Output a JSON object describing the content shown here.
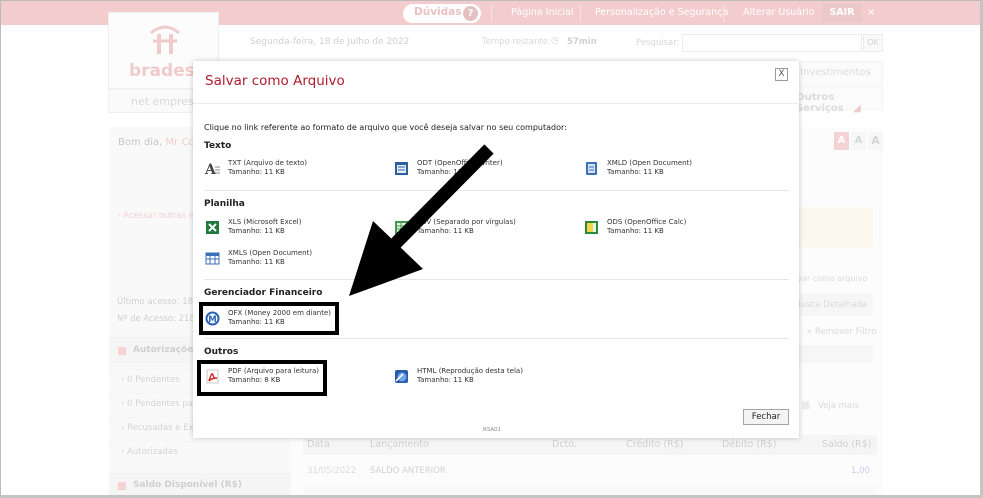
{
  "topbar": {
    "duvidas": "Dúvidas",
    "links": [
      "Página Inicial",
      "Personalização e Segurança",
      "Alterar Usuário"
    ],
    "sair": "SAIR",
    "close": "×"
  },
  "brand": {
    "logo_text": "bradesco",
    "sub_label": "net empresa"
  },
  "header": {
    "date": "Segunda-feira, 18 de Julho de 2022",
    "time_label": "Tempo restante:",
    "time_value": "57min",
    "search_label": "Pesquisar:",
    "search_value": "",
    "ok_label": "OK"
  },
  "nav": {
    "investimentos": "Investimentos",
    "outros_servicos": "Outros Serviços"
  },
  "left_panel": {
    "greeting": "Bom dia,",
    "user": "Mr Co",
    "acessar": "Acessar outras e",
    "ultimo_acesso": "Último acesso: 18/",
    "num_acesso": "Nº de Acesso: 218",
    "autorizacoes": "Autorizações",
    "items": [
      "0 Pendentes",
      "0 Pendentes para",
      "Recusadas e Exp",
      "Autorizadas"
    ],
    "saldo": "Saldo Disponível (R$)"
  },
  "right_panel": {
    "font_sizes": [
      "A",
      "A",
      "A"
    ],
    "salvar_como": "lvar como arquivo",
    "busca_detalhada": "Busca Detalhada",
    "remover_filtro": "» Remover Filtro",
    "veja_mais": "Veja mais"
  },
  "table": {
    "headers": [
      "Data",
      "Lançamento",
      "Dcto.",
      "Crédito (R$)",
      "Débito (R$)",
      "Saldo (R$)"
    ],
    "rows": [
      {
        "data": "31/05/2022",
        "lancamento": "SALDO ANTERIOR",
        "dcto": "",
        "credito": "",
        "debito": "",
        "saldo": "1,00"
      }
    ]
  },
  "modal": {
    "title": "Salvar como Arquivo",
    "close": "X",
    "intro": "Clique no link referente ao formato de arquivo que você deseja salvar no seu computador:",
    "sections": {
      "texto": {
        "title": "Texto",
        "items": [
          {
            "name": "TXT (Arquivo de texto)",
            "size": "Tamanho: 11 KB"
          },
          {
            "name": "ODT (OpenOffice Writer)",
            "size": "Tamanho: 11 KB"
          },
          {
            "name": "XMLD (Open Document)",
            "size": "Tamanho: 11 KB"
          }
        ]
      },
      "planilha": {
        "title": "Planilha",
        "items": [
          {
            "name": "XLS (Microsoft Excel)",
            "size": "Tamanho: 11 KB"
          },
          {
            "name": "CSV (Separado por vírgulas)",
            "size": "Tamanho: 11 KB"
          },
          {
            "name": "ODS (OpenOffice Calc)",
            "size": "Tamanho: 11 KB"
          },
          {
            "name": "XMLS (Open Document)",
            "size": "Tamanho: 11 KB"
          }
        ]
      },
      "gerenciador": {
        "title": "Gerenciador Financeiro",
        "items": [
          {
            "name": "OFX (Money 2000 em diante)",
            "size": "Tamanho: 11 KB"
          }
        ]
      },
      "outros": {
        "title": "Outros",
        "items": [
          {
            "name": "PDF (Arquivo para leitura)",
            "size": "Tamanho: 8 KB"
          },
          {
            "name": "HTML (Reprodução desta tela)",
            "size": "Tamanho: 11 KB"
          }
        ]
      }
    },
    "fechar": "Fechar",
    "code": "RSA01"
  },
  "colors": {
    "brand_red": "#cc092f",
    "title_red": "#b01e2e",
    "highlight": "#000000"
  }
}
